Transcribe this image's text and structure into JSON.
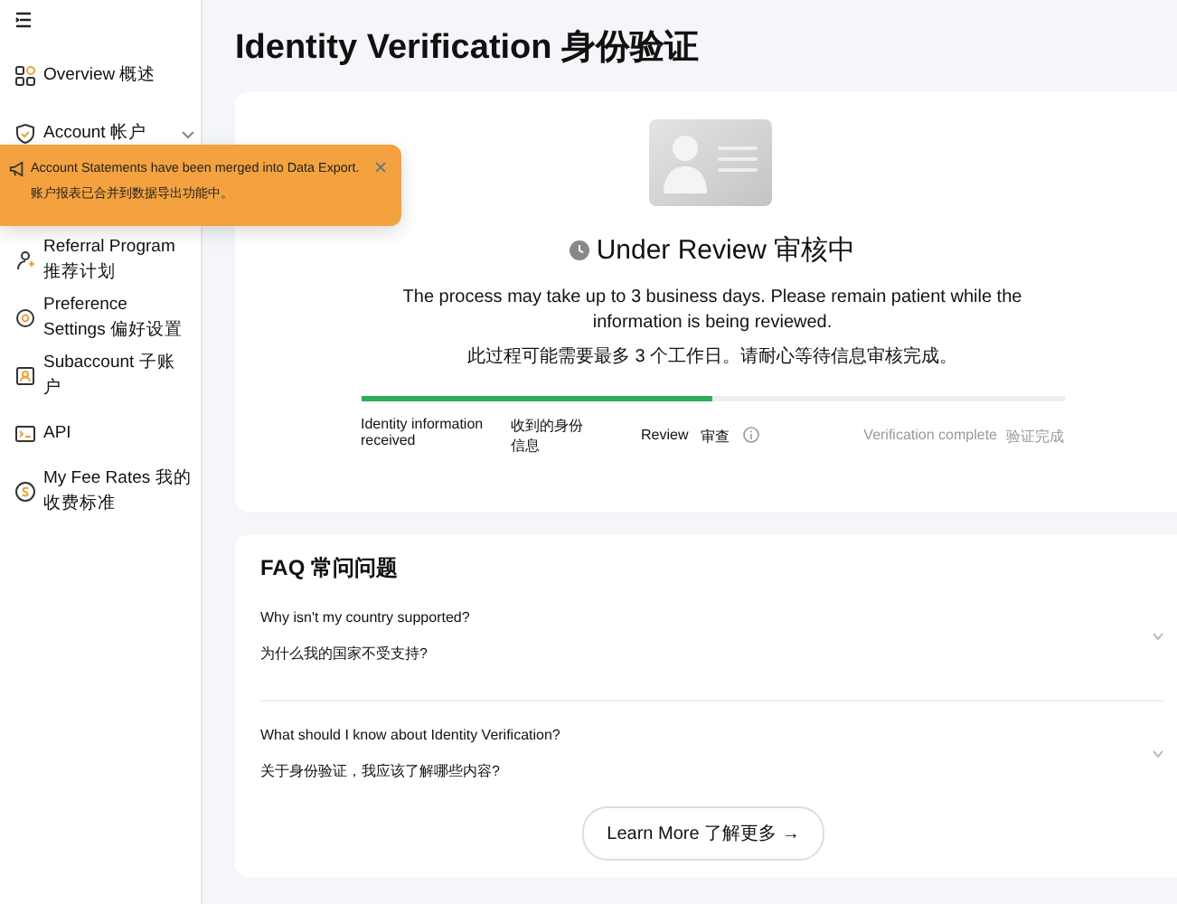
{
  "sidebar": {
    "items": [
      {
        "kind": "grid",
        "label": "Overview 概述",
        "has_submenu": false
      },
      {
        "kind": "shield",
        "label": "Account 帐户",
        "has_submenu": true
      },
      {
        "kind": "person",
        "label": "Referral Program 推荐计划",
        "has_submenu": false
      },
      {
        "kind": "gear",
        "label": "Preference Settings 偏好设置",
        "has_submenu": false
      },
      {
        "kind": "badge",
        "label": "Subaccount 子账户",
        "has_submenu": false
      },
      {
        "kind": "code",
        "label": "API",
        "has_submenu": false
      },
      {
        "kind": "coin",
        "label": "My Fee Rates 我的收费标准",
        "has_submenu": false
      }
    ]
  },
  "toast": {
    "message": "Account Statements have been merged into Data Export.",
    "message_zh": "账户报表已合并到数据导出功能中。"
  },
  "page_title": "Identity Verification 身份验证",
  "status": {
    "title": "Under Review 审核中",
    "description": "The process may take up to 3 business days. Please remain patient while the information is being reviewed.",
    "description_zh": "此过程可能需要最多 3 个工作日。请耐心等待信息审核完成。"
  },
  "progress": {
    "level": 0.5
  },
  "steps": [
    {
      "label": "Identity information received",
      "label_zh": "收到的身份信息",
      "disabled": false,
      "info": false
    },
    {
      "label": "Review",
      "label_zh": "审查",
      "disabled": false,
      "info": true
    },
    {
      "label": "Verification complete",
      "label_zh": "验证完成",
      "disabled": true,
      "info": false
    }
  ],
  "faq": {
    "title": "FAQ 常问问题",
    "items": [
      {
        "question": "Why isn't my country supported?",
        "question_zh": "为什么我的国家不受支持?",
        "expanded": false
      },
      {
        "question": "What should I know about Identity Verification?",
        "question_zh": "关于身份验证，我应该了解哪些内容?",
        "expanded": false
      }
    ],
    "button": "Learn More 了解更多 →"
  }
}
